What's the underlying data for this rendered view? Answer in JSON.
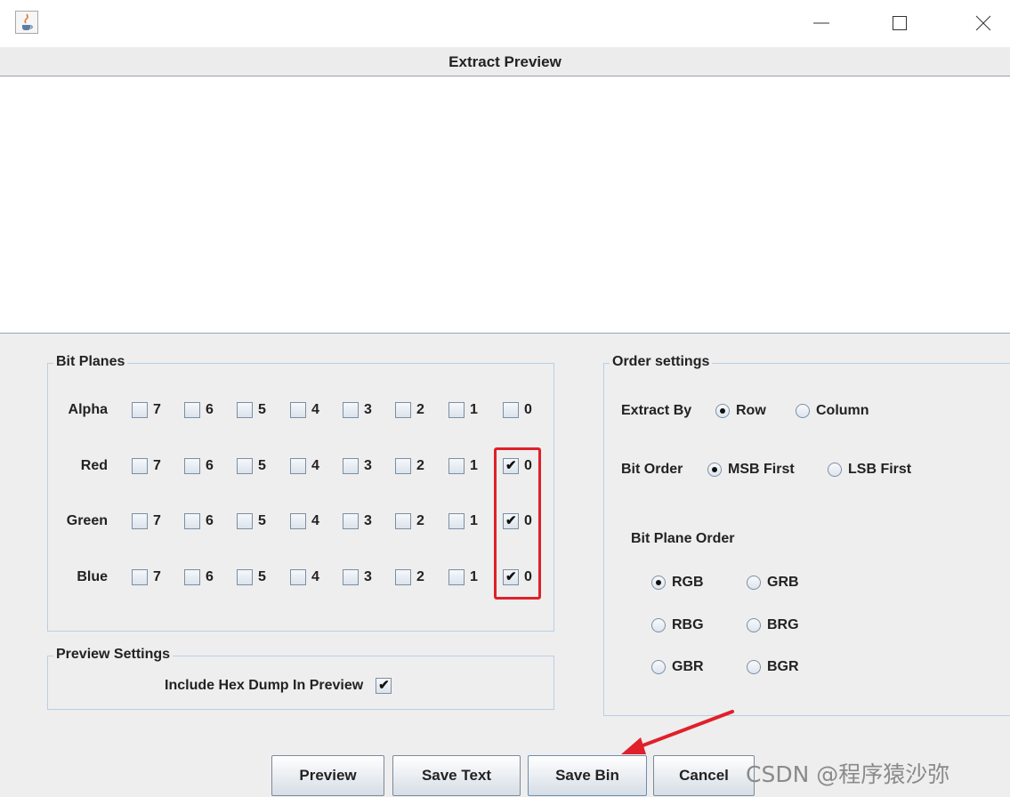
{
  "window": {
    "icon": "java-coffee-icon",
    "controls": [
      "minimize-icon",
      "maximize-icon",
      "close-icon"
    ]
  },
  "header": {
    "title": "Extract Preview"
  },
  "bit_planes": {
    "title": "Bit Planes",
    "bit_labels": [
      "7",
      "6",
      "5",
      "4",
      "3",
      "2",
      "1",
      "0"
    ],
    "rows": [
      {
        "label": "Alpha",
        "checked": [
          false,
          false,
          false,
          false,
          false,
          false,
          false,
          false
        ]
      },
      {
        "label": "Red",
        "checked": [
          false,
          false,
          false,
          false,
          false,
          false,
          false,
          true
        ]
      },
      {
        "label": "Green",
        "checked": [
          false,
          false,
          false,
          false,
          false,
          false,
          false,
          true
        ]
      },
      {
        "label": "Blue",
        "checked": [
          false,
          false,
          false,
          false,
          false,
          false,
          false,
          true
        ]
      }
    ]
  },
  "preview_settings": {
    "title": "Preview Settings",
    "hex_dump_label": "Include Hex Dump In Preview",
    "hex_dump_checked": true
  },
  "order_settings": {
    "title": "Order settings",
    "extract_by_label": "Extract By",
    "extract_by_options": [
      "Row",
      "Column"
    ],
    "extract_by_selected": "Row",
    "bit_order_label": "Bit Order",
    "bit_order_options": [
      "MSB First",
      "LSB First"
    ],
    "bit_order_selected": "MSB First",
    "plane_order_label": "Bit Plane Order",
    "plane_order_options": [
      "RGB",
      "GRB",
      "RBG",
      "BRG",
      "GBR",
      "BGR"
    ],
    "plane_order_selected": "RGB"
  },
  "buttons": {
    "preview": "Preview",
    "save_text": "Save Text",
    "save_bin": "Save Bin",
    "cancel": "Cancel"
  },
  "watermark": "CSDN @程序猿沙弥",
  "colors": {
    "highlight": "#e0202a",
    "arrow": "#e0202a",
    "group_border": "#b8cfe5"
  }
}
